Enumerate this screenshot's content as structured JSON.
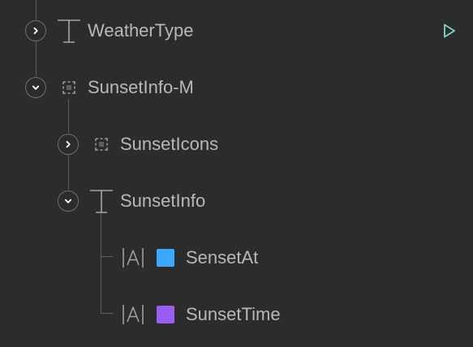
{
  "layers": {
    "weather_type": {
      "label": "WeatherType",
      "type": "text-layer"
    },
    "sunset_info_m": {
      "label": "SunsetInfo-M",
      "type": "group-layer"
    },
    "sunset_icons": {
      "label": "SunsetIcons",
      "type": "group-layer"
    },
    "sunset_info": {
      "label": "SunsetInfo",
      "type": "text-layer"
    },
    "senset_at": {
      "label": "SensetAt",
      "type": "text-style",
      "color": "#3aa9ff"
    },
    "sunset_time": {
      "label": "SunsetTime",
      "type": "text-style",
      "color": "#9b5cf2"
    }
  },
  "colors": {
    "background": "#2c2c2c",
    "label": "#b8b8b8",
    "line": "#5e5e5e",
    "accent": "#7fd6d0"
  },
  "icons": {
    "expand": "chevron-right-icon",
    "collapse": "chevron-down-icon",
    "text": "text-t-icon",
    "group": "group-icon",
    "text_style": "text-style-a-icon",
    "play": "play-icon"
  }
}
